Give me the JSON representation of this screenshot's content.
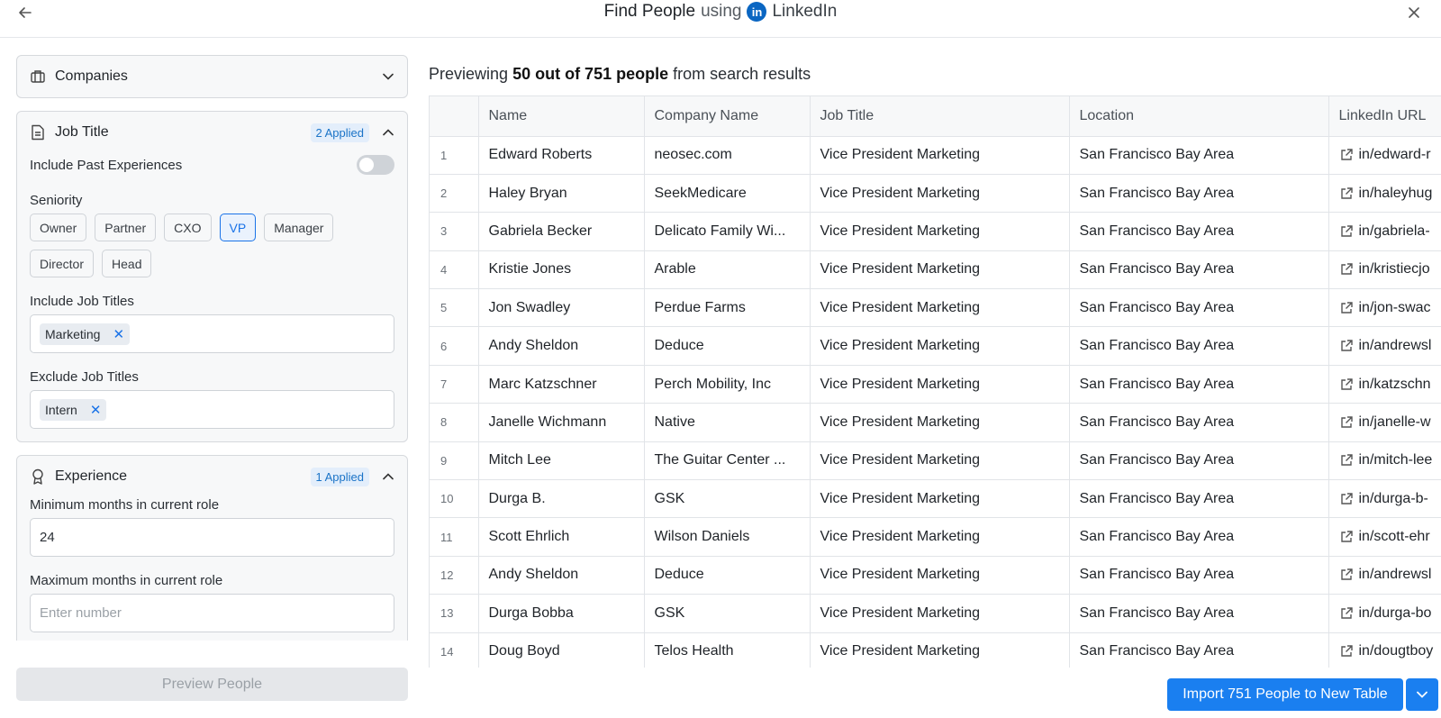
{
  "header": {
    "title_strong": "Find People",
    "title_using": "using",
    "linkedin_logo": "in",
    "linkedin_label": "LinkedIn"
  },
  "sidebar": {
    "companies": {
      "label": "Companies"
    },
    "job_title": {
      "label": "Job Title",
      "applied": "2 Applied",
      "include_past_label": "Include Past Experiences",
      "include_past_on": false,
      "seniority_label": "Seniority",
      "seniority": [
        {
          "label": "Owner",
          "selected": false
        },
        {
          "label": "Partner",
          "selected": false
        },
        {
          "label": "CXO",
          "selected": false
        },
        {
          "label": "VP",
          "selected": true
        },
        {
          "label": "Manager",
          "selected": false
        },
        {
          "label": "Director",
          "selected": false
        },
        {
          "label": "Head",
          "selected": false
        }
      ],
      "include_titles_label": "Include Job Titles",
      "include_titles": [
        "Marketing"
      ],
      "exclude_titles_label": "Exclude Job Titles",
      "exclude_titles": [
        "Intern"
      ]
    },
    "experience": {
      "label": "Experience",
      "applied": "1 Applied",
      "min_label": "Minimum months in current role",
      "min_value": "24",
      "max_label": "Maximum months in current role",
      "max_placeholder": "Enter number"
    },
    "preview_button": "Preview People"
  },
  "main": {
    "preview_prefix": "Previewing",
    "preview_count": "50 out of 751 people",
    "preview_suffix": "from search results",
    "columns": [
      "",
      "Name",
      "Company Name",
      "Job Title",
      "Location",
      "LinkedIn URL"
    ],
    "rows": [
      [
        "1",
        "Edward Roberts",
        "neosec.com",
        "Vice President Marketing",
        "San Francisco Bay Area",
        "in/edward-r"
      ],
      [
        "2",
        "Haley Bryan",
        "SeekMedicare",
        "Vice President Marketing",
        "San Francisco Bay Area",
        "in/haleyhug"
      ],
      [
        "3",
        "Gabriela Becker",
        "Delicato Family Wi...",
        "Vice President Marketing",
        "San Francisco Bay Area",
        "in/gabriela-"
      ],
      [
        "4",
        "Kristie Jones",
        "Arable",
        "Vice President Marketing",
        "San Francisco Bay Area",
        "in/kristiecjo"
      ],
      [
        "5",
        "Jon Swadley",
        "Perdue Farms",
        "Vice President Marketing",
        "San Francisco Bay Area",
        "in/jon-swac"
      ],
      [
        "6",
        "Andy Sheldon",
        "Deduce",
        "Vice President Marketing",
        "San Francisco Bay Area",
        "in/andrewsl"
      ],
      [
        "7",
        "Marc Katzschner",
        "Perch Mobility, Inc",
        "Vice President Marketing",
        "San Francisco Bay Area",
        "in/katzschn"
      ],
      [
        "8",
        "Janelle Wichmann",
        "Native",
        "Vice President Marketing",
        "San Francisco Bay Area",
        "in/janelle-w"
      ],
      [
        "9",
        "Mitch Lee",
        "The Guitar Center ...",
        "Vice President Marketing",
        "San Francisco Bay Area",
        "in/mitch-lee"
      ],
      [
        "10",
        "Durga B.",
        "GSK",
        "Vice President Marketing",
        "San Francisco Bay Area",
        "in/durga-b-"
      ],
      [
        "11",
        "Scott Ehrlich",
        "Wilson Daniels",
        "Vice President Marketing",
        "San Francisco Bay Area",
        "in/scott-ehr"
      ],
      [
        "12",
        "Andy Sheldon",
        "Deduce",
        "Vice President Marketing",
        "San Francisco Bay Area",
        "in/andrewsl"
      ],
      [
        "13",
        "Durga Bobba",
        "GSK",
        "Vice President Marketing",
        "San Francisco Bay Area",
        "in/durga-bo"
      ],
      [
        "14",
        "Doug Boyd",
        "Telos Health",
        "Vice President Marketing",
        "San Francisco Bay Area",
        "in/dougtboy"
      ]
    ],
    "import_button": "Import 751 People to New Table"
  }
}
